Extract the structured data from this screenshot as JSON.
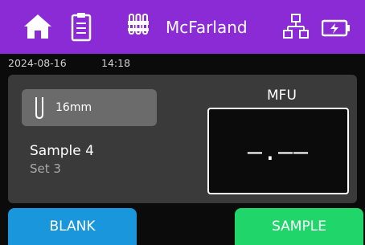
{
  "header": {
    "title": "McFarland",
    "icons": [
      "home-icon",
      "clipboard-icon",
      "tube-rack-icon",
      "network-icon",
      "battery-icon"
    ]
  },
  "status": {
    "date": "2024-08-16",
    "time": "14:18"
  },
  "panel": {
    "tube_label": "16mm",
    "sample_name": "Sample 4",
    "sample_set": "Set 3",
    "mfu_label": "MFU",
    "mfu_value": "—.——"
  },
  "buttons": {
    "blank": "BLANK",
    "sample": "SAMPLE"
  },
  "colors": {
    "header": "#8a2bd6",
    "blank": "#1a97dc",
    "sample": "#20d66b",
    "panel": "#3a3a3a"
  }
}
